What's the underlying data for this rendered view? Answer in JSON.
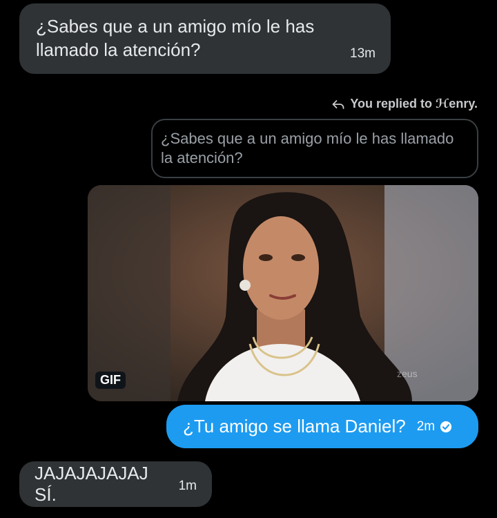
{
  "messages": {
    "first": {
      "text": "¿Sabes que a un amigo mío le has llamado la atención?",
      "time": "13m"
    },
    "reply_notice": {
      "text": "You replied to ℋenry."
    },
    "quoted": {
      "text": "¿Sabes que a un amigo mío le has llamado la atención?"
    },
    "gif": {
      "badge": "GIF",
      "watermark": "zeus"
    },
    "sent": {
      "text": "¿Tu amigo se llama Daniel?",
      "time": "2m"
    },
    "last": {
      "text": "JAJAJAJAJAJ SÍ.",
      "time": "1m"
    }
  },
  "icons": {
    "reply": "reply-arrow-icon",
    "read": "check-circle-icon"
  },
  "colors": {
    "background": "#000000",
    "incoming": "#2f3336",
    "outgoing": "#1d9bf0"
  }
}
